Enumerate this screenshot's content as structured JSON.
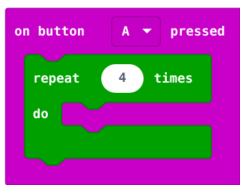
{
  "event_block": {
    "label_prefix": "on button",
    "label_suffix": "pressed",
    "button_option": "A",
    "color": "#c800c8",
    "border_color": "#8e008e"
  },
  "repeat_block": {
    "label_prefix": "repeat",
    "count": "4",
    "label_suffix": "times",
    "do_label": "do",
    "color": "#00a000",
    "border_color": "#007a00"
  }
}
